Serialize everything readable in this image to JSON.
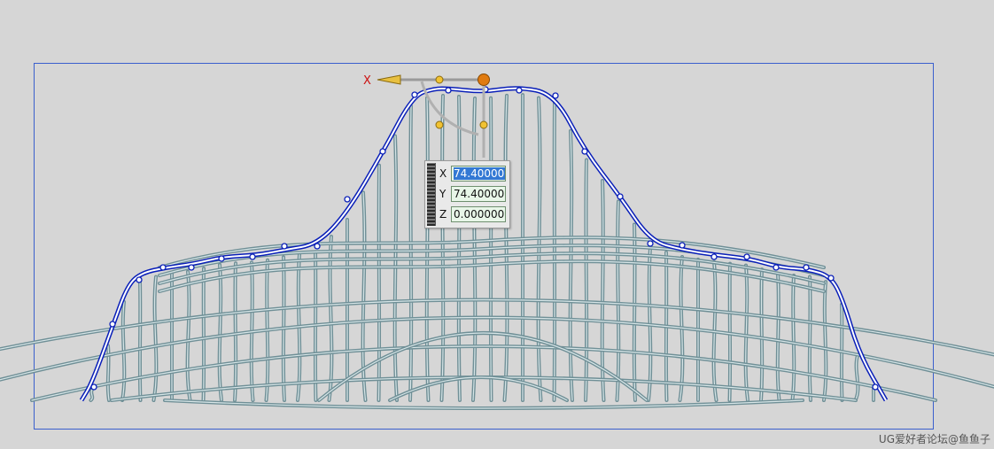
{
  "axis_label": "X",
  "coordinate_panel": {
    "x_label": "X",
    "x_value": "74.400000",
    "y_label": "Y",
    "y_value": "74.400000",
    "z_label": "Z",
    "z_value": "0.0000000"
  },
  "watermark": "UG爱好者论坛@鱼鱼子",
  "colors": {
    "background": "#d6d6d6",
    "frame": "#3a5fcd",
    "curve_blue": "#0a1fb8",
    "wires": "#6f8f96",
    "handle_orange": "#e07b10",
    "handle_yellow": "#f1c232",
    "axis_red": "#cc1111"
  }
}
